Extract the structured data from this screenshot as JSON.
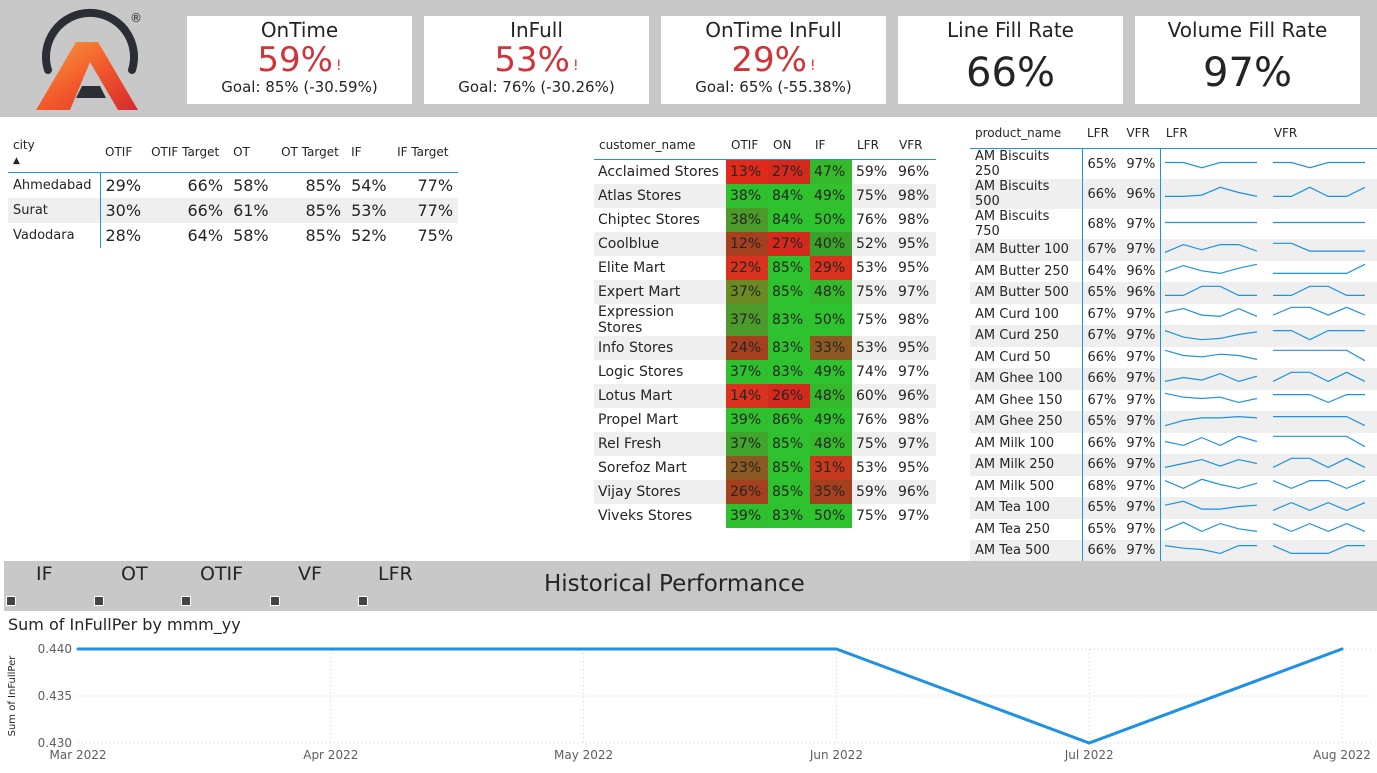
{
  "kpis": [
    {
      "title": "OnTime",
      "value": "59%",
      "alert": "!",
      "goal": "Goal: 85% (-30.59%)"
    },
    {
      "title": "InFull",
      "value": "53%",
      "alert": "!",
      "goal": "Goal: 76% (-30.26%)"
    },
    {
      "title": "OnTime InFull",
      "value": "29%",
      "alert": "!",
      "goal": "Goal: 65% (-55.38%)"
    },
    {
      "title": "Line Fill Rate",
      "value": "66%"
    },
    {
      "title": "Volume Fill Rate",
      "value": "97%"
    }
  ],
  "logo": {
    "registered": "®",
    "colors": [
      "#f25a2b",
      "#d52a2f",
      "#2b2e35"
    ]
  },
  "city_table": {
    "headers": [
      "city",
      "OTIF",
      "OTIF Target",
      "OT",
      "OT Target",
      "IF",
      "IF Target"
    ],
    "sort_indicator": "▲",
    "rows": [
      [
        "Ahmedabad",
        "29%",
        "66%",
        "58%",
        "85%",
        "54%",
        "77%"
      ],
      [
        "Surat",
        "30%",
        "66%",
        "61%",
        "85%",
        "53%",
        "77%"
      ],
      [
        "Vadodara",
        "28%",
        "64%",
        "58%",
        "85%",
        "52%",
        "75%"
      ]
    ]
  },
  "customer_table": {
    "headers": [
      "customer_name",
      "OTIF",
      "ON",
      "IF",
      "LFR",
      "VFR"
    ],
    "rows": [
      [
        "Acclaimed Stores",
        "13%",
        "27%",
        "47%",
        "59%",
        "96%"
      ],
      [
        "Atlas Stores",
        "38%",
        "84%",
        "49%",
        "75%",
        "98%"
      ],
      [
        "Chiptec Stores",
        "38%",
        "84%",
        "50%",
        "76%",
        "98%"
      ],
      [
        "Coolblue",
        "12%",
        "27%",
        "40%",
        "52%",
        "95%"
      ],
      [
        "Elite Mart",
        "22%",
        "85%",
        "29%",
        "53%",
        "95%"
      ],
      [
        "Expert Mart",
        "37%",
        "85%",
        "48%",
        "75%",
        "97%"
      ],
      [
        "Expression Stores",
        "37%",
        "83%",
        "50%",
        "75%",
        "98%"
      ],
      [
        "Info Stores",
        "24%",
        "83%",
        "33%",
        "53%",
        "95%"
      ],
      [
        "Logic Stores",
        "37%",
        "83%",
        "49%",
        "74%",
        "97%"
      ],
      [
        "Lotus Mart",
        "14%",
        "26%",
        "48%",
        "60%",
        "96%"
      ],
      [
        "Propel Mart",
        "39%",
        "86%",
        "49%",
        "76%",
        "98%"
      ],
      [
        "Rel Fresh",
        "37%",
        "85%",
        "48%",
        "75%",
        "97%"
      ],
      [
        "Sorefoz Mart",
        "23%",
        "85%",
        "31%",
        "53%",
        "95%"
      ],
      [
        "Vijay Stores",
        "26%",
        "85%",
        "35%",
        "59%",
        "96%"
      ],
      [
        "Viveks Stores",
        "39%",
        "83%",
        "50%",
        "75%",
        "97%"
      ]
    ],
    "cell_colors": [
      [
        "#e02a1c",
        "#d42a1e",
        "#36b82c"
      ],
      [
        "#2fbf2f",
        "#2ec32e",
        "#33c02f"
      ],
      [
        "#4c9a2a",
        "#2ec32e",
        "#2ec32e"
      ],
      [
        "#a5401f",
        "#d42a1e",
        "#3aa22a"
      ],
      [
        "#d9321e",
        "#2ec32e",
        "#d9321e"
      ],
      [
        "#6b8a24",
        "#2ec32e",
        "#36b82c"
      ],
      [
        "#4c9a2a",
        "#2ec32e",
        "#2ec32e"
      ],
      [
        "#a5401f",
        "#2ec32e",
        "#8a5a22"
      ],
      [
        "#2fbf2f",
        "#2ec32e",
        "#2ec32e"
      ],
      [
        "#d9321e",
        "#d42a1e",
        "#36b82c"
      ],
      [
        "#2fbf2f",
        "#2ec32e",
        "#2ec32e"
      ],
      [
        "#3fa52c",
        "#2ec32e",
        "#36b82c"
      ],
      [
        "#8a5a22",
        "#2ec32e",
        "#c63a1f"
      ],
      [
        "#a5401f",
        "#2ec32e",
        "#a5401f"
      ],
      [
        "#2fbf2f",
        "#2ec32e",
        "#2ec32e"
      ]
    ]
  },
  "product_table": {
    "headers": [
      "product_name",
      "LFR",
      "VFR",
      "LFR",
      "VFR"
    ],
    "rows": [
      {
        "name": "AM Biscuits 250",
        "lfr": "65%",
        "vfr": "97%",
        "lfr_trend": [
          0.5,
          0.5,
          0.1,
          0.5,
          0.5,
          0.5
        ],
        "vfr_trend": [
          0.5,
          0.5,
          0.1,
          0.5,
          0.5,
          0.5
        ]
      },
      {
        "name": "AM Biscuits 500",
        "lfr": "66%",
        "vfr": "96%",
        "lfr_trend": [
          0.2,
          0.2,
          0.3,
          0.9,
          0.5,
          0.2
        ],
        "vfr_trend": [
          0.2,
          0.2,
          0.9,
          0.2,
          0.2,
          0.9
        ]
      },
      {
        "name": "AM Biscuits 750",
        "lfr": "68%",
        "vfr": "97%",
        "lfr_trend": [
          0.5,
          0.5,
          0.5,
          0.5,
          0.5,
          0.5
        ],
        "vfr_trend": [
          0.5,
          0.5,
          0.5,
          0.5,
          0.5,
          0.5
        ]
      },
      {
        "name": "AM Butter 100",
        "lfr": "67%",
        "vfr": "97%",
        "lfr_trend": [
          0.2,
          0.8,
          0.4,
          0.8,
          0.8,
          0.3
        ],
        "vfr_trend": [
          0.9,
          0.9,
          0.3,
          0.3,
          0.3,
          0.3
        ]
      },
      {
        "name": "AM Butter 250",
        "lfr": "64%",
        "vfr": "96%",
        "lfr_trend": [
          0.3,
          0.8,
          0.4,
          0.2,
          0.6,
          0.9
        ],
        "vfr_trend": [
          0.2,
          0.2,
          0.2,
          0.2,
          0.2,
          0.9
        ]
      },
      {
        "name": "AM Butter 500",
        "lfr": "65%",
        "vfr": "96%",
        "lfr_trend": [
          0.2,
          0.2,
          0.9,
          0.9,
          0.2,
          0.2
        ],
        "vfr_trend": [
          0.2,
          0.2,
          0.9,
          0.9,
          0.2,
          0.2
        ]
      },
      {
        "name": "AM Curd 100",
        "lfr": "67%",
        "vfr": "97%",
        "lfr_trend": [
          0.5,
          0.8,
          0.3,
          0.2,
          0.8,
          0.2
        ],
        "vfr_trend": [
          0.3,
          0.9,
          0.9,
          0.3,
          0.9,
          0.3
        ]
      },
      {
        "name": "AM Curd 250",
        "lfr": "67%",
        "vfr": "97%",
        "lfr_trend": [
          0.8,
          0.3,
          0.1,
          0.2,
          0.5,
          0.7
        ],
        "vfr_trend": [
          0.8,
          0.8,
          0.1,
          0.8,
          0.8,
          0.8
        ]
      },
      {
        "name": "AM Curd 50",
        "lfr": "66%",
        "vfr": "97%",
        "lfr_trend": [
          0.9,
          0.5,
          0.4,
          0.6,
          0.5,
          0.2
        ],
        "vfr_trend": [
          0.9,
          0.9,
          0.9,
          0.9,
          0.9,
          0.1
        ]
      },
      {
        "name": "AM Ghee 100",
        "lfr": "66%",
        "vfr": "97%",
        "lfr_trend": [
          0.2,
          0.5,
          0.3,
          0.8,
          0.2,
          0.6
        ],
        "vfr_trend": [
          0.2,
          0.9,
          0.9,
          0.2,
          0.9,
          0.2
        ]
      },
      {
        "name": "AM Ghee 150",
        "lfr": "67%",
        "vfr": "97%",
        "lfr_trend": [
          0.9,
          0.6,
          0.5,
          0.6,
          0.2,
          0.5
        ],
        "vfr_trend": [
          0.8,
          0.8,
          0.8,
          0.2,
          0.8,
          0.8
        ]
      },
      {
        "name": "AM Ghee 250",
        "lfr": "65%",
        "vfr": "97%",
        "lfr_trend": [
          0.1,
          0.5,
          0.7,
          0.7,
          0.8,
          0.7
        ],
        "vfr_trend": [
          0.8,
          0.8,
          0.8,
          0.8,
          0.8,
          0.1
        ]
      },
      {
        "name": "AM Milk 100",
        "lfr": "66%",
        "vfr": "97%",
        "lfr_trend": [
          0.5,
          0.2,
          0.8,
          0.2,
          0.9,
          0.5
        ],
        "vfr_trend": [
          0.9,
          0.9,
          0.9,
          0.9,
          0.9,
          0.1
        ]
      },
      {
        "name": "AM Milk 250",
        "lfr": "66%",
        "vfr": "97%",
        "lfr_trend": [
          0.2,
          0.5,
          0.8,
          0.3,
          0.8,
          0.5
        ],
        "vfr_trend": [
          0.2,
          0.9,
          0.9,
          0.2,
          0.9,
          0.2
        ]
      },
      {
        "name": "AM Milk 500",
        "lfr": "68%",
        "vfr": "97%",
        "lfr_trend": [
          0.8,
          0.2,
          0.9,
          0.5,
          0.2,
          0.6
        ],
        "vfr_trend": [
          0.8,
          0.2,
          0.8,
          0.8,
          0.2,
          0.8
        ]
      },
      {
        "name": "AM Tea 100",
        "lfr": "65%",
        "vfr": "97%",
        "lfr_trend": [
          0.6,
          0.9,
          0.3,
          0.3,
          0.5,
          0.6
        ],
        "vfr_trend": [
          0.2,
          0.8,
          0.2,
          0.8,
          0.2,
          0.8
        ]
      },
      {
        "name": "AM Tea 250",
        "lfr": "65%",
        "vfr": "97%",
        "lfr_trend": [
          0.3,
          0.9,
          0.2,
          0.8,
          0.4,
          0.2
        ],
        "vfr_trend": [
          0.8,
          0.2,
          0.8,
          0.2,
          0.8,
          0.2
        ]
      },
      {
        "name": "AM Tea 500",
        "lfr": "66%",
        "vfr": "97%",
        "lfr_trend": [
          0.8,
          0.6,
          0.5,
          0.2,
          0.8,
          0.8
        ],
        "vfr_trend": [
          0.8,
          0.2,
          0.2,
          0.2,
          0.8,
          0.8
        ]
      }
    ]
  },
  "historical": {
    "slicers": [
      "IF",
      "OT",
      "OTIF",
      "VF",
      "LFR"
    ],
    "title": "Historical Performance"
  },
  "chart_data": {
    "type": "line",
    "title": "Sum of InFullPer by mmm_yy",
    "xlabel": "",
    "ylabel": "Sum of InFullPer",
    "categories": [
      "Mar 2022",
      "Apr 2022",
      "May 2022",
      "Jun 2022",
      "Jul 2022",
      "Aug 2022"
    ],
    "values": [
      0.44,
      0.44,
      0.44,
      0.44,
      0.43,
      0.44
    ],
    "yticks": [
      "0.440",
      "0.435",
      "0.430"
    ],
    "ylim": [
      0.43,
      0.44
    ],
    "grid": true,
    "color": "#1f91e2"
  }
}
